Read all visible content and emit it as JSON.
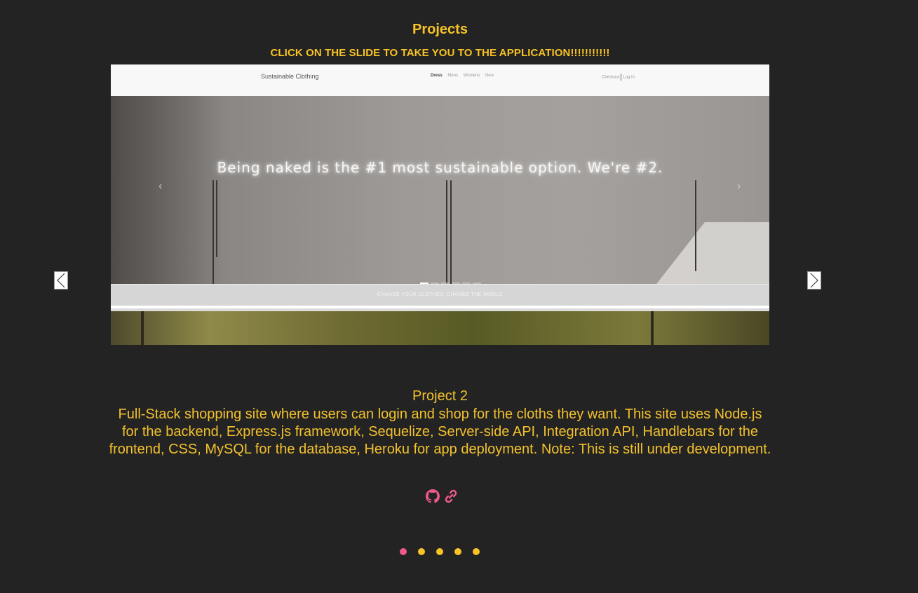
{
  "section": {
    "title": "Projects",
    "instruction": "CLICK ON THE SLIDE TO TAKE YOU TO THE APPLICATION!!!!!!!!!!!"
  },
  "slide": {
    "site_brand": "Sustainable Clothing",
    "site_nav": [
      "Dress",
      "Mens",
      "Womens",
      "New"
    ],
    "site_checkout": "Checkout",
    "site_login": "Log In",
    "hero_text": "Being naked is the #1 most sustainable option. We're #2.",
    "banner_text": "CHANGE YOUR CLOTHES, CHANGE THE WORLD",
    "hero_indicator_count": 6
  },
  "project": {
    "name": "Project 2",
    "description": "Full-Stack shopping site where users can login and shop for the cloths they want. This site uses Node.js for the backend, Express.js framework, Sequelize, Server-side API, Integration API, Handlebars for the frontend, CSS, MySQL for the database, Heroku for app deployment. Note: This is still under development."
  },
  "links": {
    "icons": [
      "github-icon",
      "link-icon"
    ],
    "color": "#f05a8a"
  },
  "carousel": {
    "slide_count": 5,
    "active_index": 0,
    "active_color": "#f05a8a",
    "inactive_color": "#f7c325"
  },
  "colors": {
    "background": "#232323",
    "accent": "#f3c12d"
  }
}
